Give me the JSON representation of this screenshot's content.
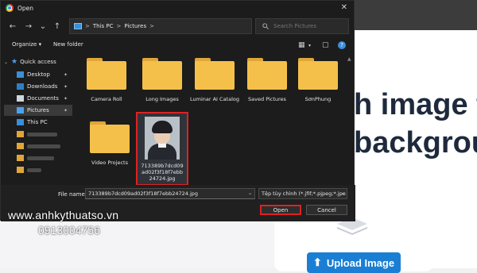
{
  "window": {
    "title": "Open",
    "close_glyph": "✕"
  },
  "navigation": {
    "back_glyph": "←",
    "forward_glyph": "→",
    "recent_glyph": "⌄",
    "up_glyph": "↑",
    "address": {
      "crumbs": [
        "This PC",
        "Pictures"
      ],
      "separator": ">"
    },
    "dropdown_glyph": "⌄",
    "refresh_glyph": "↻",
    "search": {
      "placeholder": "Search Pictures",
      "icon": "search-icon"
    }
  },
  "toolbar": {
    "organize_label": "Organize ▾",
    "new_folder_label": "New folder",
    "view_glyph": "▦",
    "view_dd": "▾",
    "pane_glyph": "▢",
    "help_glyph": "?"
  },
  "sidebar": {
    "quick_access_label": "Quick access",
    "items": [
      {
        "label": "Desktop",
        "icon": "desktop-icon"
      },
      {
        "label": "Downloads",
        "icon": "downloads-icon"
      },
      {
        "label": "Documents",
        "icon": "documents-icon"
      },
      {
        "label": "Pictures",
        "icon": "pictures-icon"
      },
      {
        "label": "This PC",
        "icon": "pc-icon"
      }
    ],
    "pin_glyph": "📌"
  },
  "files": {
    "folders": [
      {
        "label": "Camera Roll"
      },
      {
        "label": "Long Images"
      },
      {
        "label": "Luminar AI Catalog"
      },
      {
        "label": "Saved Pictures"
      },
      {
        "label": "SơnPhung"
      },
      {
        "label": "Video Projects"
      }
    ],
    "selected_file": {
      "label": "713389b7dcd09ad02f3f18f7ebb24724.jpg"
    }
  },
  "footer": {
    "file_name_label": "File name:",
    "file_name_value": "713389b7dcd09ad02f3f18f7ebb24724.jpg",
    "file_type_value": "Tệp tùy chỉnh (*.jfif;*.pjpeg;*.jpe",
    "open_label": "Open",
    "cancel_label": "Cancel"
  },
  "background_page": {
    "headline_line1": "h image t",
    "headline_line2": "backgrou",
    "upload_button_label": "Upload Image"
  },
  "watermark": {
    "url": "www.anhkythuatso.vn",
    "phone": "0913004756"
  },
  "colors": {
    "dialog_bg": "#1c1c1c",
    "folder": "#f5c04a",
    "highlight_red": "#dd2222",
    "upload_blue": "#1a7fd4"
  }
}
